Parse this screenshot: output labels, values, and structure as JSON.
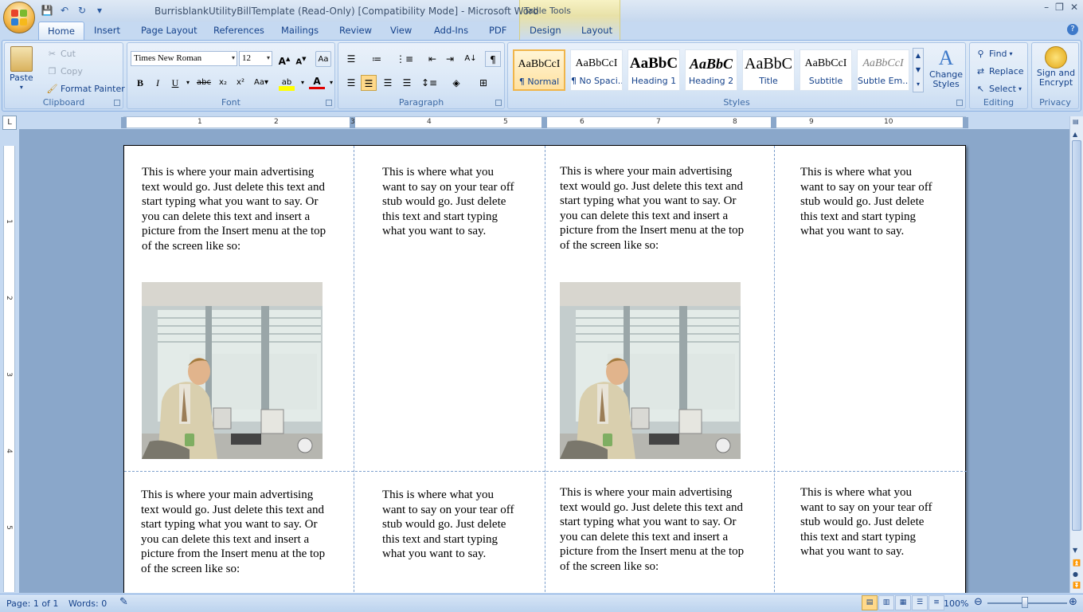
{
  "window": {
    "title": "BurrisblankUtilityBillTemplate (Read-Only) [Compatibility Mode] - Microsoft Word",
    "context_tab_label": "Table Tools"
  },
  "tabs": [
    "Home",
    "Insert",
    "Page Layout",
    "References",
    "Mailings",
    "Review",
    "View",
    "Add-Ins",
    "PDF",
    "Design",
    "Layout"
  ],
  "clipboard": {
    "paste": "Paste",
    "cut": "Cut",
    "copy": "Copy",
    "format_painter": "Format Painter",
    "label": "Clipboard"
  },
  "font": {
    "name": "Times New Roman",
    "size": "12",
    "label": "Font"
  },
  "paragraph": {
    "label": "Paragraph"
  },
  "styles": {
    "items": [
      {
        "preview": "AaBbCcI",
        "name": "¶ Normal"
      },
      {
        "preview": "AaBbCcI",
        "name": "¶ No Spaci..."
      },
      {
        "preview": "AaBbC",
        "name": "Heading 1"
      },
      {
        "preview": "AaBbC",
        "name": "Heading 2"
      },
      {
        "preview": "AaBbC",
        "name": "Title"
      },
      {
        "preview": "AaBbCcI",
        "name": "Subtitle"
      },
      {
        "preview": "AaBbCcI",
        "name": "Subtle Em..."
      }
    ],
    "change_styles": "Change Styles",
    "label": "Styles"
  },
  "editing": {
    "find": "Find",
    "replace": "Replace",
    "select": "Select",
    "label": "Editing"
  },
  "privacy": {
    "sign": "Sign and Encrypt",
    "label": "Privacy"
  },
  "ruler": {
    "numbers": [
      "1",
      "2",
      "3",
      "4",
      "5",
      "6",
      "7",
      "8",
      "9",
      "10"
    ]
  },
  "vruler": {
    "numbers": [
      "1",
      "2",
      "3",
      "4",
      "5"
    ]
  },
  "doc": {
    "main_text": "This is where your main advertising text would go. Just delete this text and start typing what you want to say. Or you can delete this text and insert  a picture from the Insert menu  at the top of the screen like  so:",
    "stub_text": "This is  where what you want to say on your tear off stub would go. Just delete this text and start typing what you want to say."
  },
  "status": {
    "page": "Page: 1 of 1",
    "words": "Words: 0",
    "zoom": "100%"
  },
  "colors": {
    "ribbon_bg": "#dfeaf7",
    "page_bg": "#8aa7ca",
    "accent": "#15428b"
  }
}
